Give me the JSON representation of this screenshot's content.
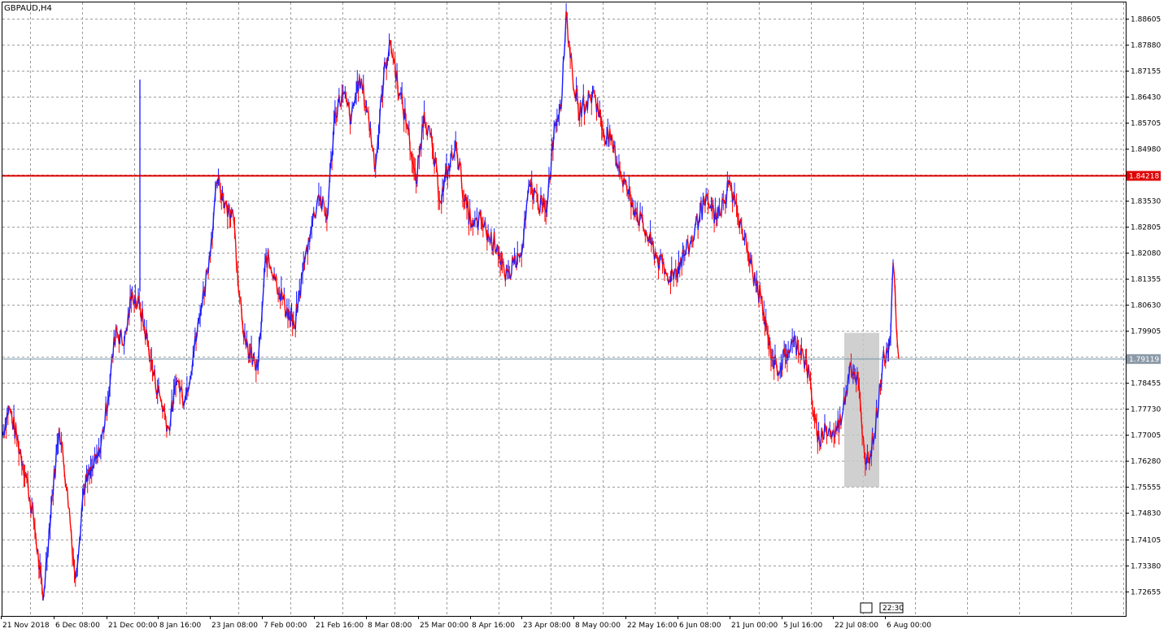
{
  "symbol_label": "GBPAUD,H4",
  "colors": {
    "background": "#ffffff",
    "grid": "#9c9c9c",
    "axis": "#000000",
    "bull": "#1a1aff",
    "bear": "#ff0000",
    "hline": "#e00000",
    "current_line": "#6f8fa8",
    "current_tag": "#8c9aa8",
    "highlight": "#c8c8c8"
  },
  "chart_data": {
    "type": "line",
    "title": "GBPAUD,H4",
    "grid": true,
    "ylim": [
      1.7226,
      1.8897
    ],
    "y_ticks": [
      "1.88605",
      "1.87880",
      "1.87155",
      "1.86430",
      "1.85705",
      "1.84980",
      "1.84255",
      "1.83530",
      "1.82805",
      "1.82080",
      "1.81355",
      "1.80630",
      "1.79905",
      "1.79180",
      "1.78455",
      "1.77730",
      "1.77005",
      "1.76280",
      "1.75555",
      "1.74830",
      "1.74105",
      "1.73380",
      "1.72655"
    ],
    "x_ticks": [
      "21 Nov 2018",
      "6 Dec 08:00",
      "21 Dec 00:00",
      "8 Jan 16:00",
      "23 Jan 08:00",
      "7 Feb 00:00",
      "21 Feb 16:00",
      "8 Mar 08:00",
      "25 Mar 00:00",
      "8 Apr 16:00",
      "23 Apr 08:00",
      "8 May 00:00",
      "22 May 16:00",
      "6 Jun 08:00",
      "21 Jun 00:00",
      "5 Jul 16:00",
      "22 Jul 08:00",
      "6 Aug 00:00"
    ],
    "series": [
      {
        "name": "",
        "x": [
          "21 Nov 2018",
          "6 Dec 08:00",
          "21 Dec 00:00",
          "8 Jan 16:00",
          "23 Jan 08:00",
          "7 Feb 00:00",
          "21 Feb 16:00",
          "8 Mar 08:00",
          "25 Mar 00:00",
          "8 Apr 16:00",
          "23 Apr 08:00",
          "8 May 00:00",
          "22 May 16:00",
          "6 Jun 08:00",
          "21 Jun 00:00",
          "5 Jul 16:00",
          "22 Jul 08:00",
          "6 Aug 00:00"
        ],
        "values": [
          1.775,
          1.752,
          1.79,
          1.778,
          1.838,
          1.802,
          1.842,
          1.871,
          1.845,
          1.82,
          1.837,
          1.86,
          1.825,
          1.832,
          1.825,
          1.791,
          1.78,
          1.7912
        ]
      }
    ],
    "price_points": [
      {
        "t": 0,
        "p": 1.77
      },
      {
        "t": 8,
        "p": 1.778
      },
      {
        "t": 30,
        "p": 1.758
      },
      {
        "t": 40,
        "p": 1.744
      },
      {
        "t": 50,
        "p": 1.724
      },
      {
        "t": 60,
        "p": 1.75
      },
      {
        "t": 70,
        "p": 1.772
      },
      {
        "t": 80,
        "p": 1.755
      },
      {
        "t": 90,
        "p": 1.73
      },
      {
        "t": 100,
        "p": 1.755
      },
      {
        "t": 110,
        "p": 1.76
      },
      {
        "t": 120,
        "p": 1.765
      },
      {
        "t": 130,
        "p": 1.78
      },
      {
        "t": 140,
        "p": 1.8
      },
      {
        "t": 150,
        "p": 1.795
      },
      {
        "t": 160,
        "p": 1.81
      },
      {
        "t": 170,
        "p": 1.805
      },
      {
        "t": 180,
        "p": 1.795
      },
      {
        "t": 185,
        "p": 1.788
      },
      {
        "t": 195,
        "p": 1.78
      },
      {
        "t": 205,
        "p": 1.772
      },
      {
        "t": 215,
        "p": 1.785
      },
      {
        "t": 225,
        "p": 1.78
      },
      {
        "t": 235,
        "p": 1.792
      },
      {
        "t": 245,
        "p": 1.805
      },
      {
        "t": 255,
        "p": 1.82
      },
      {
        "t": 265,
        "p": 1.84
      },
      {
        "t": 275,
        "p": 1.835
      },
      {
        "t": 285,
        "p": 1.83
      },
      {
        "t": 290,
        "p": 1.815
      },
      {
        "t": 300,
        "p": 1.795
      },
      {
        "t": 315,
        "p": 1.788
      },
      {
        "t": 325,
        "p": 1.82
      },
      {
        "t": 335,
        "p": 1.815
      },
      {
        "t": 345,
        "p": 1.808
      },
      {
        "t": 360,
        "p": 1.8
      },
      {
        "t": 370,
        "p": 1.815
      },
      {
        "t": 380,
        "p": 1.827
      },
      {
        "t": 390,
        "p": 1.837
      },
      {
        "t": 400,
        "p": 1.83
      },
      {
        "t": 410,
        "p": 1.86
      },
      {
        "t": 420,
        "p": 1.865
      },
      {
        "t": 430,
        "p": 1.858
      },
      {
        "t": 440,
        "p": 1.87
      },
      {
        "t": 450,
        "p": 1.86
      },
      {
        "t": 460,
        "p": 1.845
      },
      {
        "t": 470,
        "p": 1.87
      },
      {
        "t": 478,
        "p": 1.88
      },
      {
        "t": 490,
        "p": 1.865
      },
      {
        "t": 500,
        "p": 1.855
      },
      {
        "t": 510,
        "p": 1.84
      },
      {
        "t": 520,
        "p": 1.86
      },
      {
        "t": 530,
        "p": 1.85
      },
      {
        "t": 540,
        "p": 1.835
      },
      {
        "t": 550,
        "p": 1.845
      },
      {
        "t": 560,
        "p": 1.85
      },
      {
        "t": 570,
        "p": 1.835
      },
      {
        "t": 580,
        "p": 1.828
      },
      {
        "t": 590,
        "p": 1.83
      },
      {
        "t": 600,
        "p": 1.825
      },
      {
        "t": 610,
        "p": 1.823
      },
      {
        "t": 620,
        "p": 1.813
      },
      {
        "t": 630,
        "p": 1.818
      },
      {
        "t": 640,
        "p": 1.82
      },
      {
        "t": 650,
        "p": 1.84
      },
      {
        "t": 660,
        "p": 1.835
      },
      {
        "t": 670,
        "p": 1.832
      },
      {
        "t": 680,
        "p": 1.855
      },
      {
        "t": 690,
        "p": 1.865
      },
      {
        "t": 695,
        "p": 1.888
      },
      {
        "t": 700,
        "p": 1.875
      },
      {
        "t": 710,
        "p": 1.86
      },
      {
        "t": 720,
        "p": 1.863
      },
      {
        "t": 730,
        "p": 1.865
      },
      {
        "t": 740,
        "p": 1.855
      },
      {
        "t": 750,
        "p": 1.852
      },
      {
        "t": 760,
        "p": 1.845
      },
      {
        "t": 770,
        "p": 1.838
      },
      {
        "t": 780,
        "p": 1.833
      },
      {
        "t": 790,
        "p": 1.828
      },
      {
        "t": 800,
        "p": 1.823
      },
      {
        "t": 810,
        "p": 1.818
      },
      {
        "t": 820,
        "p": 1.814
      },
      {
        "t": 830,
        "p": 1.816
      },
      {
        "t": 840,
        "p": 1.82
      },
      {
        "t": 850,
        "p": 1.824
      },
      {
        "t": 860,
        "p": 1.832
      },
      {
        "t": 870,
        "p": 1.835
      },
      {
        "t": 880,
        "p": 1.83
      },
      {
        "t": 890,
        "p": 1.835
      },
      {
        "t": 895,
        "p": 1.84
      },
      {
        "t": 905,
        "p": 1.834
      },
      {
        "t": 915,
        "p": 1.825
      },
      {
        "t": 925,
        "p": 1.815
      },
      {
        "t": 935,
        "p": 1.808
      },
      {
        "t": 945,
        "p": 1.795
      },
      {
        "t": 955,
        "p": 1.788
      },
      {
        "t": 965,
        "p": 1.792
      },
      {
        "t": 975,
        "p": 1.796
      },
      {
        "t": 985,
        "p": 1.794
      },
      {
        "t": 995,
        "p": 1.786
      },
      {
        "t": 1005,
        "p": 1.768
      },
      {
        "t": 1015,
        "p": 1.772
      },
      {
        "t": 1025,
        "p": 1.77
      },
      {
        "t": 1035,
        "p": 1.775
      },
      {
        "t": 1045,
        "p": 1.79
      },
      {
        "t": 1055,
        "p": 1.785
      },
      {
        "t": 1060,
        "p": 1.77
      },
      {
        "t": 1065,
        "p": 1.762
      },
      {
        "t": 1075,
        "p": 1.77
      },
      {
        "t": 1085,
        "p": 1.79
      },
      {
        "t": 1095,
        "p": 1.798
      },
      {
        "t": 1098,
        "p": 1.818
      },
      {
        "t": 1102,
        "p": 1.8
      },
      {
        "t": 1105,
        "p": 1.7912
      }
    ],
    "horizontal_line": {
      "price": 1.84218,
      "label": "1.84218"
    },
    "current_price": {
      "price": 1.79119,
      "label": "1.79119"
    },
    "highlight": {
      "x_start": "22 Jul 08:00",
      "x_end": "6 Aug 00:00",
      "p_low": 1.75555,
      "p_high": 1.7985
    },
    "time_marker": {
      "label": "22:30"
    }
  }
}
